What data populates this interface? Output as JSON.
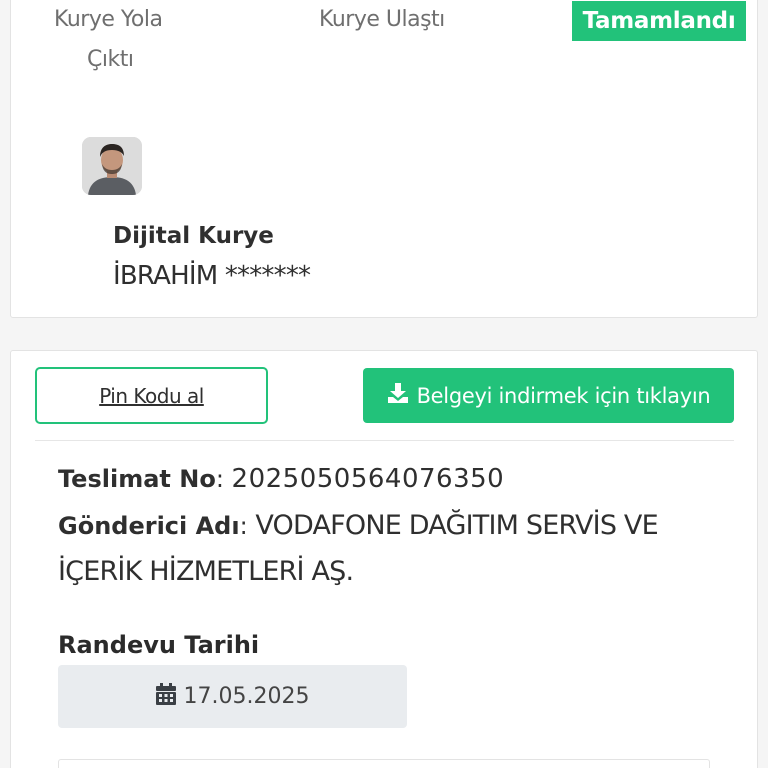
{
  "status_steps": {
    "step1_line1": "Kurye Yola",
    "step1_line2": "Çıktı",
    "step2": "Kurye Ulaştı",
    "step3": "Tamamlandı"
  },
  "courier": {
    "title": "Dijital Kurye",
    "name": "İBRAHİM *******"
  },
  "actions": {
    "pin_label": "Pin Kodu al",
    "download_label": "Belgeyi indirmek için tıklayın"
  },
  "delivery": {
    "number_label": "Teslimat No",
    "number_value": "2025050564076350",
    "sender_label": "Gönderici Adı",
    "sender_value_line1": "VODAFONE DAĞITIM SERVİS VE",
    "sender_value_line2": "İÇERİK HİZMETLERİ AŞ.",
    "date_label": "Randevu Tarihi",
    "date_value": "17.05.2025"
  },
  "colors": {
    "accent": "#22c27a"
  },
  "icons": {
    "download": "download-icon",
    "calendar": "calendar-icon"
  }
}
